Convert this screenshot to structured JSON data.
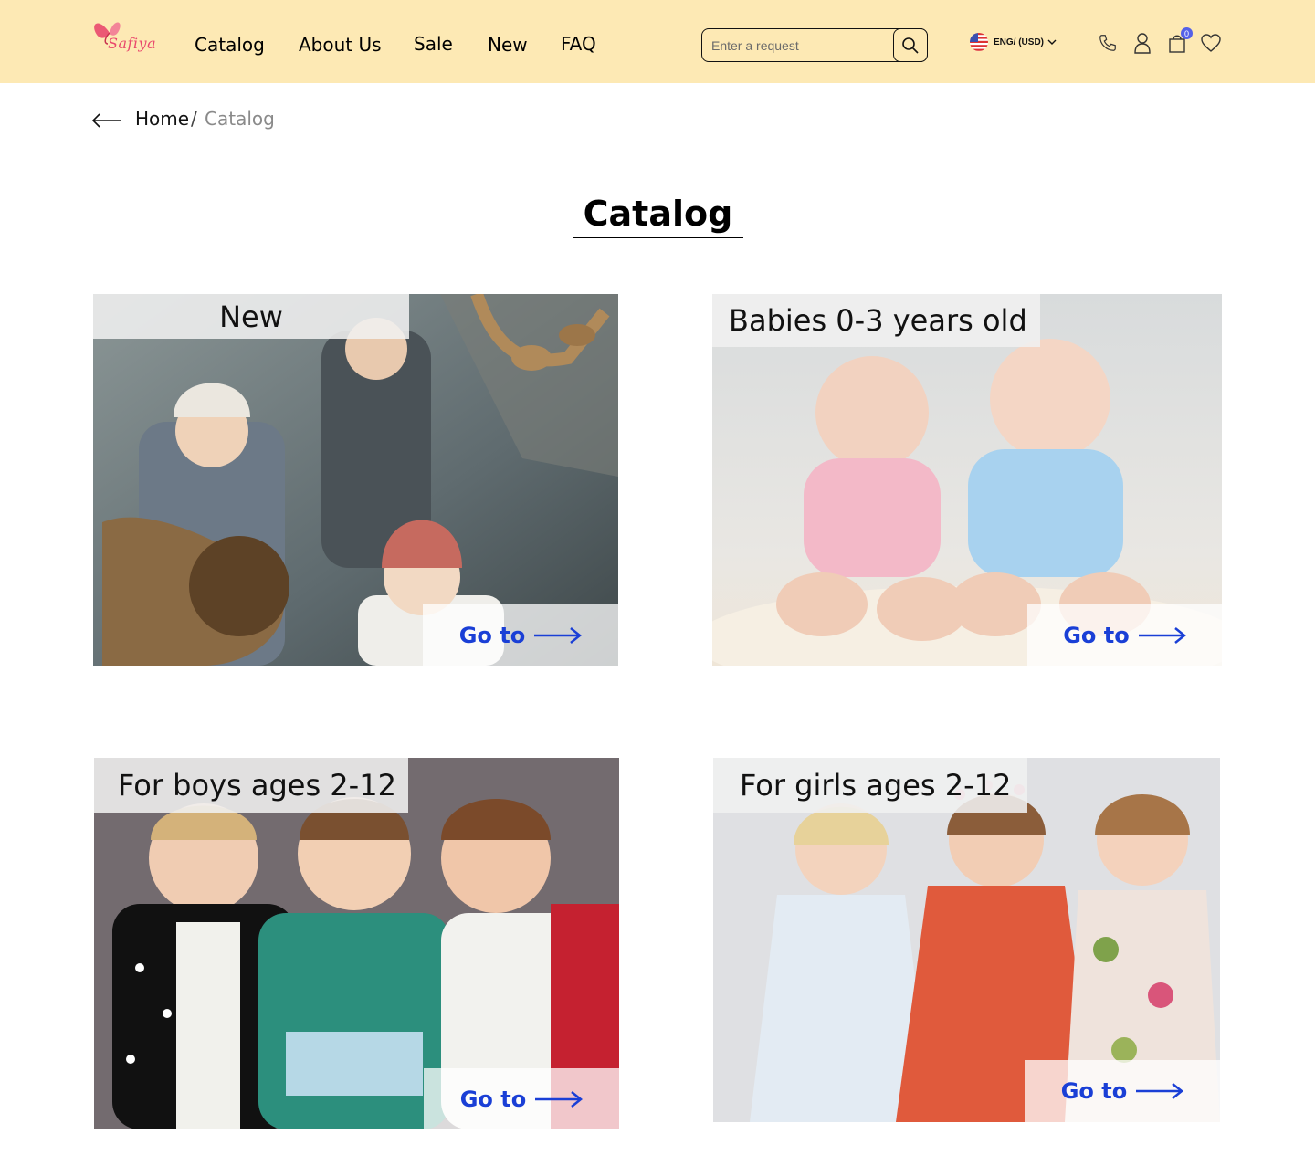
{
  "header": {
    "logo_text": "Safiya",
    "nav": [
      "Catalog",
      "About Us",
      "Sale",
      "New",
      "FAQ"
    ],
    "search_placeholder": "Enter a request",
    "locale_label": "ENG/ (USD)",
    "cart_count": "0",
    "icons": [
      "search-icon",
      "us-flag-icon",
      "chevron-down-icon",
      "phone-icon",
      "user-icon",
      "cart-icon",
      "heart-icon"
    ]
  },
  "breadcrumb": {
    "home": "Home",
    "separator": "/",
    "current": "Catalog"
  },
  "page": {
    "title": "Catalog"
  },
  "categories": [
    {
      "label": "New",
      "cta": "Go to"
    },
    {
      "label": "Babies 0-3 years old",
      "cta": "Go to"
    },
    {
      "label": "For boys ages 2-12",
      "cta": "Go to"
    },
    {
      "label": "For girls ages 2-12",
      "cta": "Go to"
    }
  ],
  "colors": {
    "header_bg": "#fde9b4",
    "brand": "#e9496d",
    "link": "#1a3fd6",
    "badge": "#5561e8"
  }
}
